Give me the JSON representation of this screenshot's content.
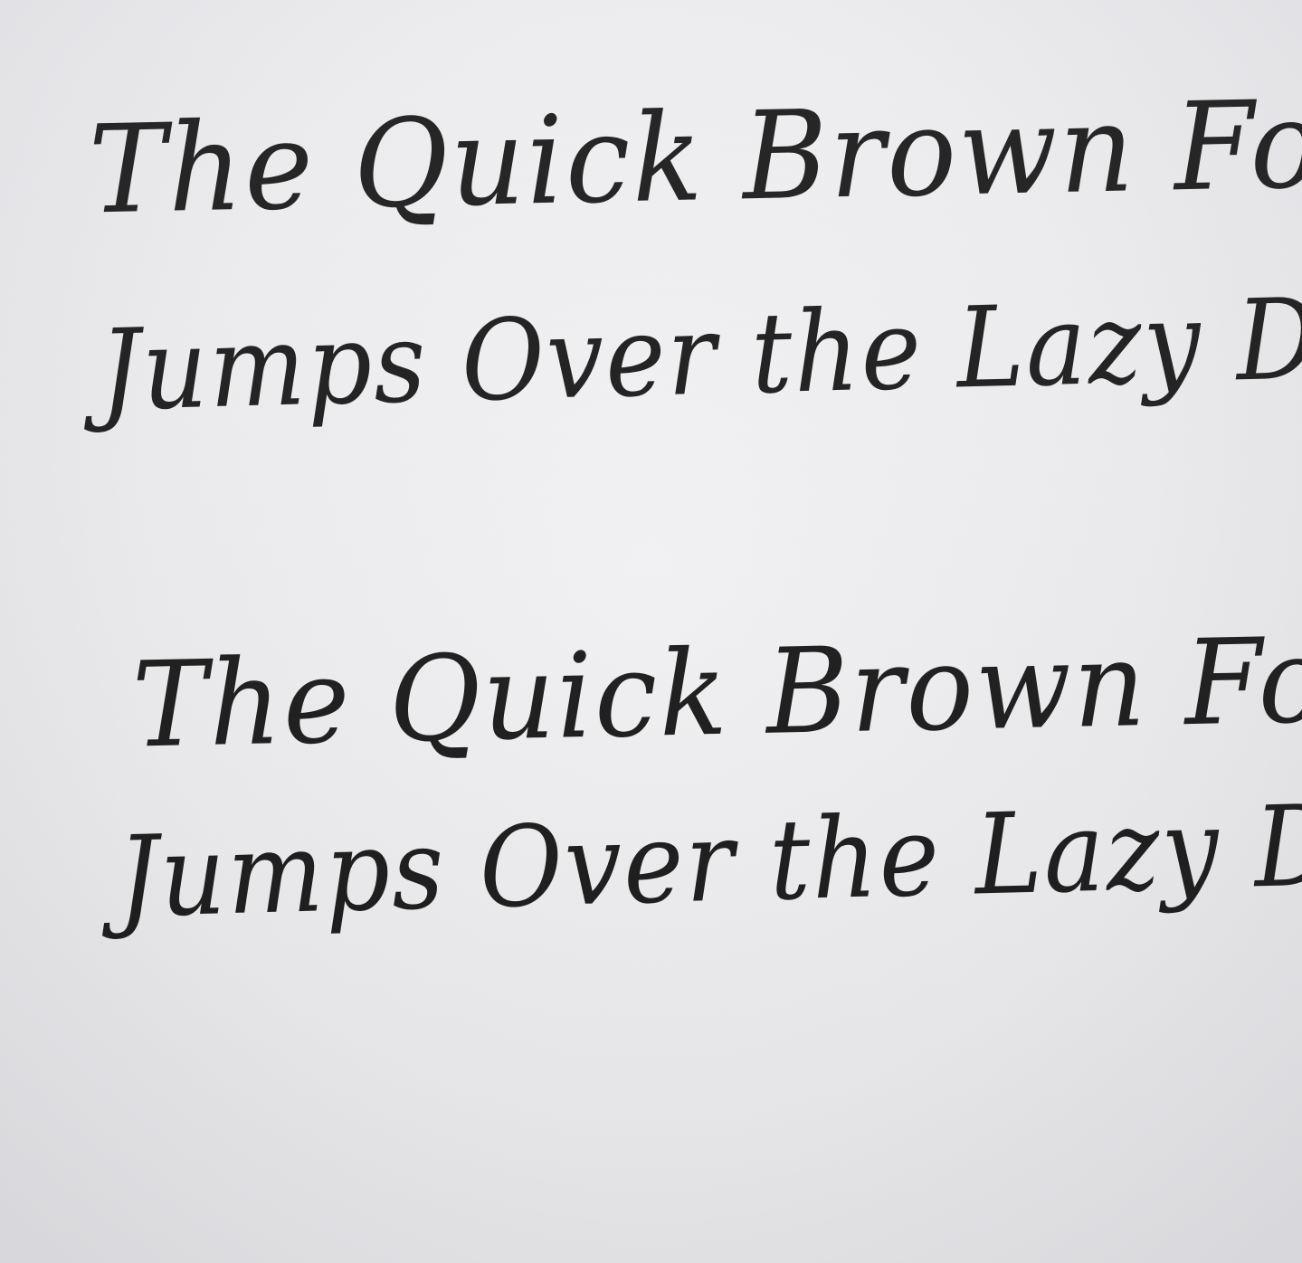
{
  "sample_1": {
    "line_1": "The Quick Brown Fox",
    "line_2": "Jumps Over the Lazy Dog"
  },
  "sample_2": {
    "line_1": "The Quick Brown Fox",
    "line_2": "Jumps Over the Lazy Dog"
  },
  "colors": {
    "paper": "#ececee",
    "ink": "#1c1c1c"
  }
}
